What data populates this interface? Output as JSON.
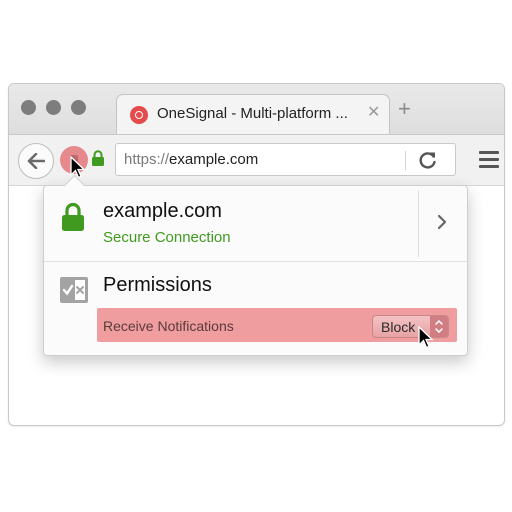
{
  "browser": {
    "tab": {
      "title": "OneSignal - Multi-platform ...",
      "favicon": "onesignal-icon",
      "close": "✕"
    },
    "new_tab": "+",
    "url": {
      "scheme": "https://",
      "host": "example.com"
    }
  },
  "popup": {
    "identity": {
      "host": "example.com",
      "status": "Secure Connection"
    },
    "permissions": {
      "title": "Permissions",
      "notification_label": "Receive Notifications",
      "notification_value": "Block"
    }
  },
  "colors": {
    "secure_green": "#3f9a1f",
    "highlight_red": "#ef9d9f",
    "favicon_red": "#e54b4d"
  }
}
